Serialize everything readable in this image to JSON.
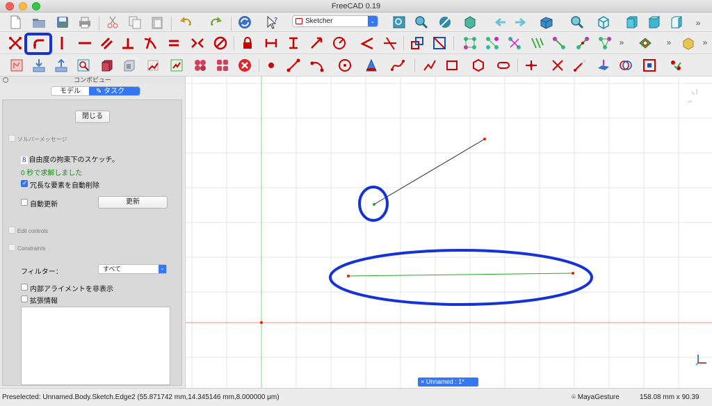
{
  "window": {
    "title": "FreeCAD 0.19"
  },
  "workbench": {
    "selected": "Sketcher"
  },
  "combo": {
    "title": "コンボビュー",
    "tabs": [
      {
        "label": "モデル"
      },
      {
        "label": "タスク"
      }
    ],
    "close_button": "閉じる",
    "solver_section": "ソルバーメッセージ",
    "dof_count": "8",
    "dof_text": "自由度の拘束下のスケッチ。",
    "solved_text": "0 秒で求解しました",
    "auto_remove_label": "冗長な要素を自動削除",
    "auto_update_label": "自動更新",
    "update_button": "更新",
    "edit_controls_section": "Edit controls",
    "constraints_section": "Constraints",
    "filter_label": "フィルター：",
    "filter_value": "すべて",
    "hide_internal_label": "内部アライメントを非表示",
    "extended_info_label": "拡張情報"
  },
  "document_tab": {
    "label": "× Unnamed : 1*"
  },
  "status": {
    "preselected": "Preselected: Unnamed.Body.Sketch.Edge2 (55.871742 mm,14.345146 mm,8.000000 μm)",
    "navigation": "MayaGesture",
    "dimensions": "158.08 mm x 90.39 mm"
  },
  "colors": {
    "accent": "#3478f6",
    "highlight": "#1532d8",
    "sketch_red": "#cc1111",
    "construction_green": "#0a9a0a"
  }
}
